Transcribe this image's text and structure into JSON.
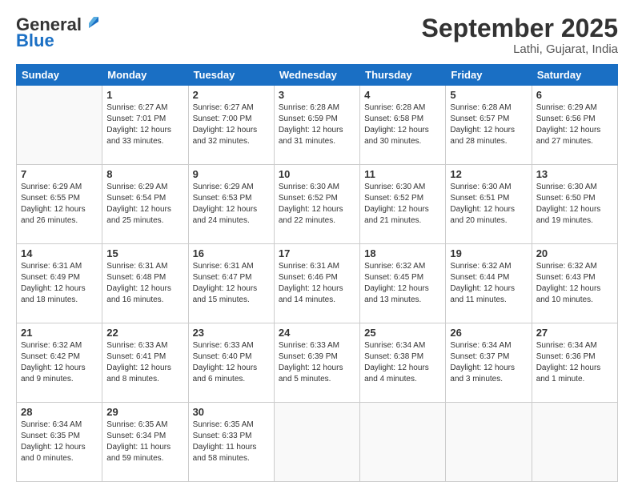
{
  "header": {
    "logo_general": "General",
    "logo_blue": "Blue",
    "month": "September 2025",
    "location": "Lathi, Gujarat, India"
  },
  "days_of_week": [
    "Sunday",
    "Monday",
    "Tuesday",
    "Wednesday",
    "Thursday",
    "Friday",
    "Saturday"
  ],
  "weeks": [
    [
      {
        "day": "",
        "info": ""
      },
      {
        "day": "1",
        "info": "Sunrise: 6:27 AM\nSunset: 7:01 PM\nDaylight: 12 hours\nand 33 minutes."
      },
      {
        "day": "2",
        "info": "Sunrise: 6:27 AM\nSunset: 7:00 PM\nDaylight: 12 hours\nand 32 minutes."
      },
      {
        "day": "3",
        "info": "Sunrise: 6:28 AM\nSunset: 6:59 PM\nDaylight: 12 hours\nand 31 minutes."
      },
      {
        "day": "4",
        "info": "Sunrise: 6:28 AM\nSunset: 6:58 PM\nDaylight: 12 hours\nand 30 minutes."
      },
      {
        "day": "5",
        "info": "Sunrise: 6:28 AM\nSunset: 6:57 PM\nDaylight: 12 hours\nand 28 minutes."
      },
      {
        "day": "6",
        "info": "Sunrise: 6:29 AM\nSunset: 6:56 PM\nDaylight: 12 hours\nand 27 minutes."
      }
    ],
    [
      {
        "day": "7",
        "info": "Sunrise: 6:29 AM\nSunset: 6:55 PM\nDaylight: 12 hours\nand 26 minutes."
      },
      {
        "day": "8",
        "info": "Sunrise: 6:29 AM\nSunset: 6:54 PM\nDaylight: 12 hours\nand 25 minutes."
      },
      {
        "day": "9",
        "info": "Sunrise: 6:29 AM\nSunset: 6:53 PM\nDaylight: 12 hours\nand 24 minutes."
      },
      {
        "day": "10",
        "info": "Sunrise: 6:30 AM\nSunset: 6:52 PM\nDaylight: 12 hours\nand 22 minutes."
      },
      {
        "day": "11",
        "info": "Sunrise: 6:30 AM\nSunset: 6:52 PM\nDaylight: 12 hours\nand 21 minutes."
      },
      {
        "day": "12",
        "info": "Sunrise: 6:30 AM\nSunset: 6:51 PM\nDaylight: 12 hours\nand 20 minutes."
      },
      {
        "day": "13",
        "info": "Sunrise: 6:30 AM\nSunset: 6:50 PM\nDaylight: 12 hours\nand 19 minutes."
      }
    ],
    [
      {
        "day": "14",
        "info": "Sunrise: 6:31 AM\nSunset: 6:49 PM\nDaylight: 12 hours\nand 18 minutes."
      },
      {
        "day": "15",
        "info": "Sunrise: 6:31 AM\nSunset: 6:48 PM\nDaylight: 12 hours\nand 16 minutes."
      },
      {
        "day": "16",
        "info": "Sunrise: 6:31 AM\nSunset: 6:47 PM\nDaylight: 12 hours\nand 15 minutes."
      },
      {
        "day": "17",
        "info": "Sunrise: 6:31 AM\nSunset: 6:46 PM\nDaylight: 12 hours\nand 14 minutes."
      },
      {
        "day": "18",
        "info": "Sunrise: 6:32 AM\nSunset: 6:45 PM\nDaylight: 12 hours\nand 13 minutes."
      },
      {
        "day": "19",
        "info": "Sunrise: 6:32 AM\nSunset: 6:44 PM\nDaylight: 12 hours\nand 11 minutes."
      },
      {
        "day": "20",
        "info": "Sunrise: 6:32 AM\nSunset: 6:43 PM\nDaylight: 12 hours\nand 10 minutes."
      }
    ],
    [
      {
        "day": "21",
        "info": "Sunrise: 6:32 AM\nSunset: 6:42 PM\nDaylight: 12 hours\nand 9 minutes."
      },
      {
        "day": "22",
        "info": "Sunrise: 6:33 AM\nSunset: 6:41 PM\nDaylight: 12 hours\nand 8 minutes."
      },
      {
        "day": "23",
        "info": "Sunrise: 6:33 AM\nSunset: 6:40 PM\nDaylight: 12 hours\nand 6 minutes."
      },
      {
        "day": "24",
        "info": "Sunrise: 6:33 AM\nSunset: 6:39 PM\nDaylight: 12 hours\nand 5 minutes."
      },
      {
        "day": "25",
        "info": "Sunrise: 6:34 AM\nSunset: 6:38 PM\nDaylight: 12 hours\nand 4 minutes."
      },
      {
        "day": "26",
        "info": "Sunrise: 6:34 AM\nSunset: 6:37 PM\nDaylight: 12 hours\nand 3 minutes."
      },
      {
        "day": "27",
        "info": "Sunrise: 6:34 AM\nSunset: 6:36 PM\nDaylight: 12 hours\nand 1 minute."
      }
    ],
    [
      {
        "day": "28",
        "info": "Sunrise: 6:34 AM\nSunset: 6:35 PM\nDaylight: 12 hours\nand 0 minutes."
      },
      {
        "day": "29",
        "info": "Sunrise: 6:35 AM\nSunset: 6:34 PM\nDaylight: 11 hours\nand 59 minutes."
      },
      {
        "day": "30",
        "info": "Sunrise: 6:35 AM\nSunset: 6:33 PM\nDaylight: 11 hours\nand 58 minutes."
      },
      {
        "day": "",
        "info": ""
      },
      {
        "day": "",
        "info": ""
      },
      {
        "day": "",
        "info": ""
      },
      {
        "day": "",
        "info": ""
      }
    ]
  ]
}
